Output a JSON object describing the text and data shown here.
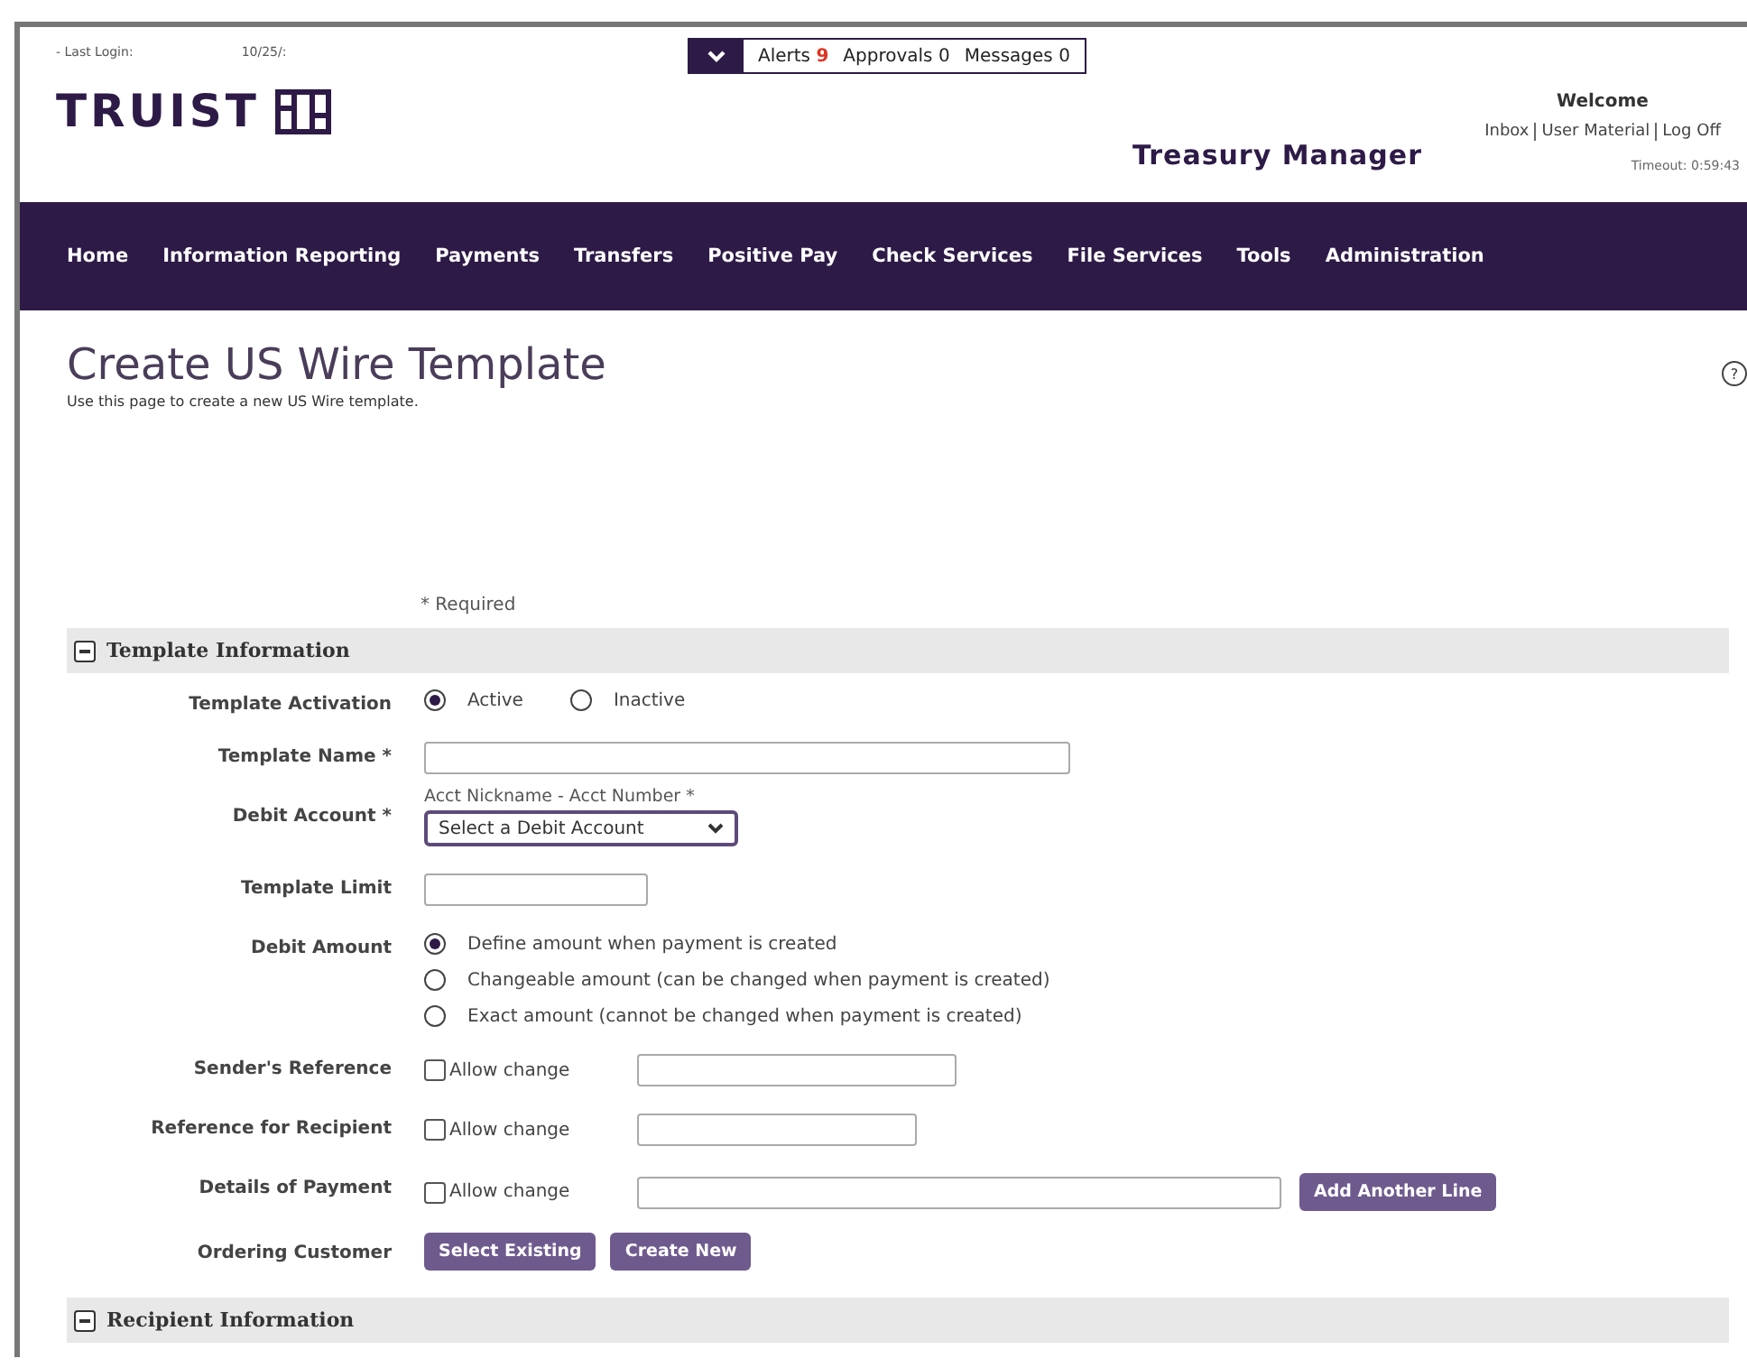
{
  "header": {
    "last_login_label": "- Last Login:",
    "last_login_value": "10/25/:",
    "logo": "TRUIST",
    "product": "Treasury Manager",
    "welcome": "Welcome",
    "links": [
      "Inbox",
      "User Material",
      "Log Off"
    ],
    "timeout": "Timeout: 0:59:43"
  },
  "notifications_menu": {
    "expanded": false
  },
  "notifications": [
    {
      "label": "Alerts",
      "count": "9",
      "highlight": true
    },
    {
      "label": "Approvals",
      "count": "0",
      "highlight": false
    },
    {
      "label": "Messages",
      "count": "0",
      "highlight": false
    }
  ],
  "nav": [
    "Home",
    "Information Reporting",
    "Payments",
    "Transfers",
    "Positive Pay",
    "Check Services",
    "File Services",
    "Tools",
    "Administration"
  ],
  "page": {
    "title": "Create US Wire Template",
    "subtitle": "Use this page to create a new US Wire template.",
    "required_note": "* Required",
    "help": "?"
  },
  "sections": [
    {
      "title": "Template Information",
      "expanded": true
    },
    {
      "title": "Recipient Information",
      "expanded": true
    }
  ],
  "fields": [
    {
      "kind": "radio",
      "label": "Template Activation",
      "options": [
        {
          "label": "Active",
          "selected": true
        },
        {
          "label": "Inactive",
          "selected": false
        }
      ]
    },
    {
      "kind": "text",
      "label": "Template Name *"
    },
    {
      "kind": "select",
      "label": "Debit Account *",
      "caption": "Acct Nickname - Acct Number *",
      "value": "Select a Debit Account"
    },
    {
      "kind": "text",
      "label": "Template Limit"
    },
    {
      "kind": "radiolist",
      "label": "Debit Amount",
      "options": [
        {
          "label": "Define amount when payment is created",
          "selected": true
        },
        {
          "label": "Changeable amount (can be changed when payment is created)",
          "selected": false
        },
        {
          "label": "Exact amount (cannot be changed when payment is created)",
          "selected": false
        }
      ]
    },
    {
      "kind": "checkinput",
      "label": "Sender's Reference",
      "check_label": "Allow change",
      "checked": false
    },
    {
      "kind": "checkinput",
      "label": "Reference for Recipient",
      "check_label": "Allow change",
      "checked": false
    },
    {
      "kind": "checkinput",
      "label": "Details of Payment",
      "check_label": "Allow change",
      "checked": false,
      "button": "Add Another Line"
    },
    {
      "kind": "buttons",
      "label": "Ordering Customer",
      "buttons": [
        "Select Existing",
        "Create New"
      ]
    }
  ]
}
